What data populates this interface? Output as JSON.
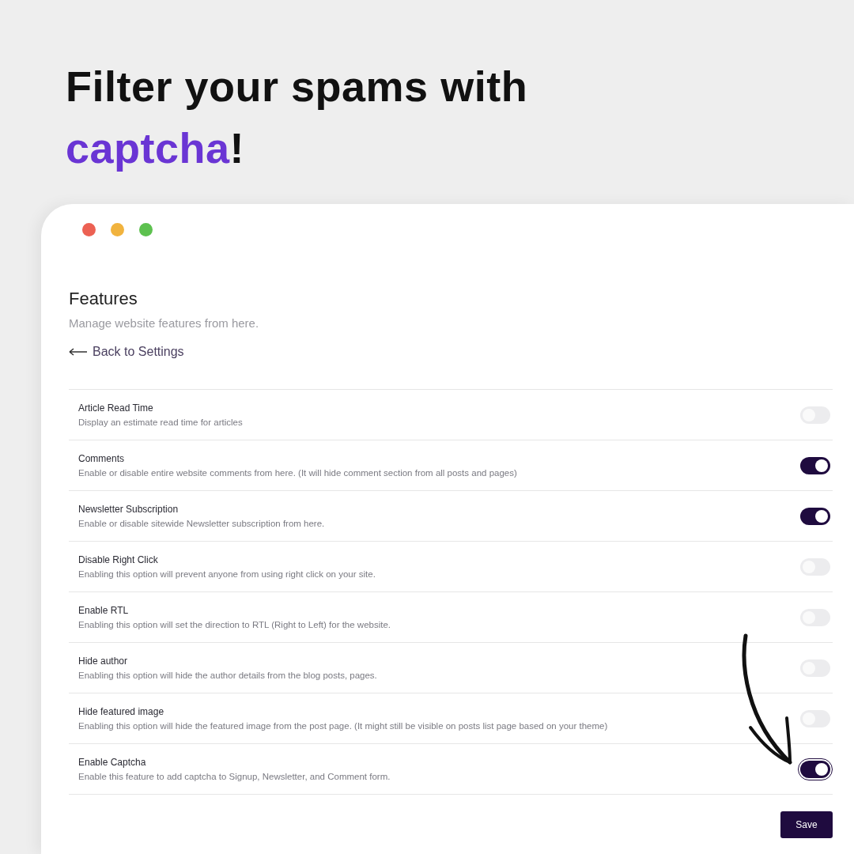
{
  "headline": "Filter your spams with *captcha*!",
  "page": {
    "title": "Features",
    "subtitle": "Manage website features from here.",
    "back_link": "Back to Settings"
  },
  "features": [
    {
      "name": "Article Read Time",
      "description": "Display an estimate read time for articles",
      "on": false
    },
    {
      "name": "Comments",
      "description": "Enable or disable entire website comments from here. (It will hide comment section from all posts and pages)",
      "on": true
    },
    {
      "name": "Newsletter Subscription",
      "description": "Enable or disable sitewide Newsletter subscription from here.",
      "on": true
    },
    {
      "name": "Disable Right Click",
      "description": "Enabling this option will prevent anyone from using right click on your site.",
      "on": false
    },
    {
      "name": "Enable RTL",
      "description": "Enabling this option will set the direction to RTL (Right to Left) for the website.",
      "on": false
    },
    {
      "name": "Hide author",
      "description": "Enabling this option will hide the author details from the blog posts, pages.",
      "on": false
    },
    {
      "name": "Hide featured image",
      "description": "Enabling this option will hide the featured image from the post page. (It might still be visible on posts list page based on your theme)",
      "on": false
    },
    {
      "name": "Enable Captcha",
      "description": "Enable this feature to add captcha to Signup, Newsletter, and Comment form.",
      "on": true,
      "focused": true
    }
  ],
  "save_button": "Save"
}
